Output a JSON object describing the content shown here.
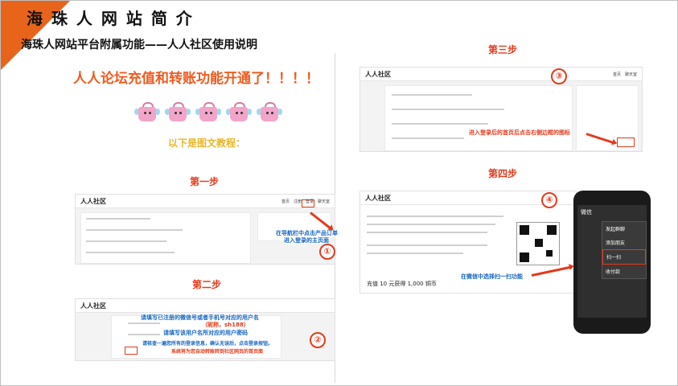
{
  "slide": {
    "title": "海 珠 人 网 站 简 介",
    "subtitle": "海珠人网站平台附属功能——人人社区使用说明",
    "headline": "人人论坛充值和转账功能开通了！！！！",
    "tutorial_label": "以下是图文教程：",
    "accent_color": "#e8641b",
    "step_color": "#e33a1c"
  },
  "steps": {
    "step1": "第一步",
    "step2": "第二步",
    "step3": "第三步",
    "step4": "第四步"
  },
  "screens": {
    "logo": "人人社区",
    "nav_items": [
      "首页",
      "注册",
      "登录",
      "聊天室"
    ],
    "circles": [
      "①",
      "②",
      "③",
      "④"
    ],
    "step1_note": "在导航栏中点击产品订单",
    "step1_note2": "进入登录的主页面",
    "step2_note1": "请填写已注册的微信号或者手机号对应的用户名",
    "step2_note2": "（昵称，sh188）",
    "step2_note3": "请填写该用户名所对应的用户密码",
    "step2_note4": "请核查一遍您所有的登录信息，确认无误后，点击登录按钮。",
    "step2_note5": "系统将为您自动转账转到社区网页的首页面",
    "step3_note": "进入登录后的首页后点击右侧边框的图标",
    "step4_note": "在微信中选择扫一扫功能",
    "step4_balance": "充值 10 元获得 1,000 铜币",
    "wechat_label": "微信",
    "wechat_menu": [
      "发起群聊",
      "添加朋友",
      "扫一扫",
      "收付款"
    ]
  }
}
